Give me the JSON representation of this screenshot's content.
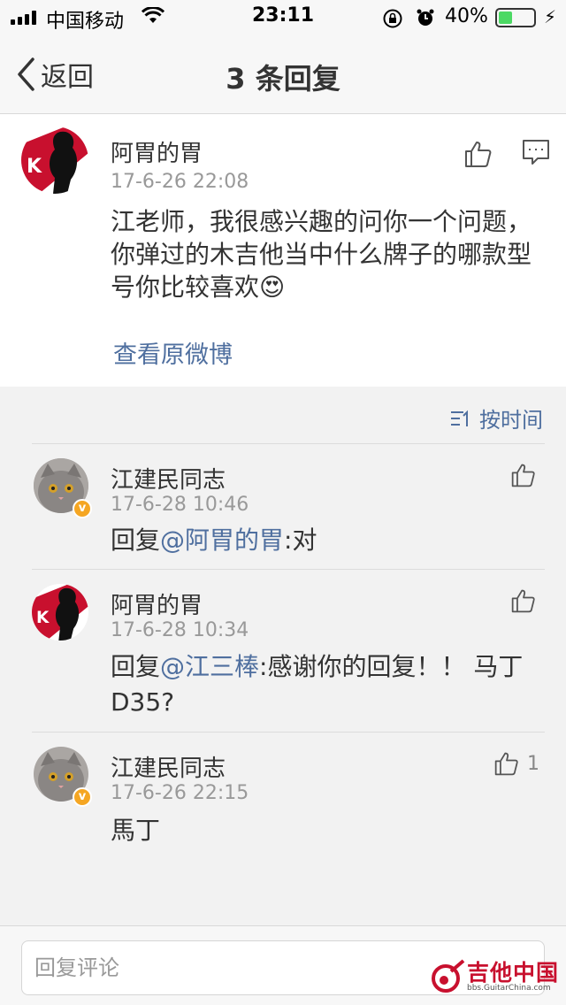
{
  "status_bar": {
    "carrier": "中国移动",
    "time": "23:11",
    "battery_percent": "40%",
    "battery_level": 0.4,
    "icons": [
      "signal-icon",
      "wifi-icon",
      "orientation-lock-icon",
      "alarm-icon",
      "battery-icon",
      "charging-icon"
    ]
  },
  "nav": {
    "back_label": "返回",
    "title": "3 条回复"
  },
  "original": {
    "username": "阿胃的胃",
    "time": "17-6-26 22:08",
    "text": "江老师，我很感兴趣的问你一个问题，你弹过的木吉他当中什么牌子的哪款型号你比较喜欢",
    "emoji": "😍",
    "view_original": "查看原微博"
  },
  "sort_label": "按时间",
  "replies": [
    {
      "username": "江建民同志",
      "time": "17-6-28 10:46",
      "prefix": "回复",
      "mention": "@阿胃的胃",
      "text": ":对",
      "likes": ""
    },
    {
      "username": "阿胃的胃",
      "time": "17-6-28 10:34",
      "prefix": "回复",
      "mention": "@江三棒",
      "text": ":感谢你的回复！！ 马丁D35?",
      "likes": ""
    },
    {
      "username": "江建民同志",
      "time": "17-6-26 22:15",
      "prefix": "",
      "mention": "",
      "text": "馬丁",
      "likes": "1"
    }
  ],
  "input": {
    "placeholder": "回复评论"
  },
  "watermark": {
    "title": "吉他中国",
    "url": "bbs.GuitarChina.com"
  },
  "colors": {
    "link": "#4f6f9f",
    "verify_badge": "#f5a623",
    "battery": "#4cd964"
  }
}
